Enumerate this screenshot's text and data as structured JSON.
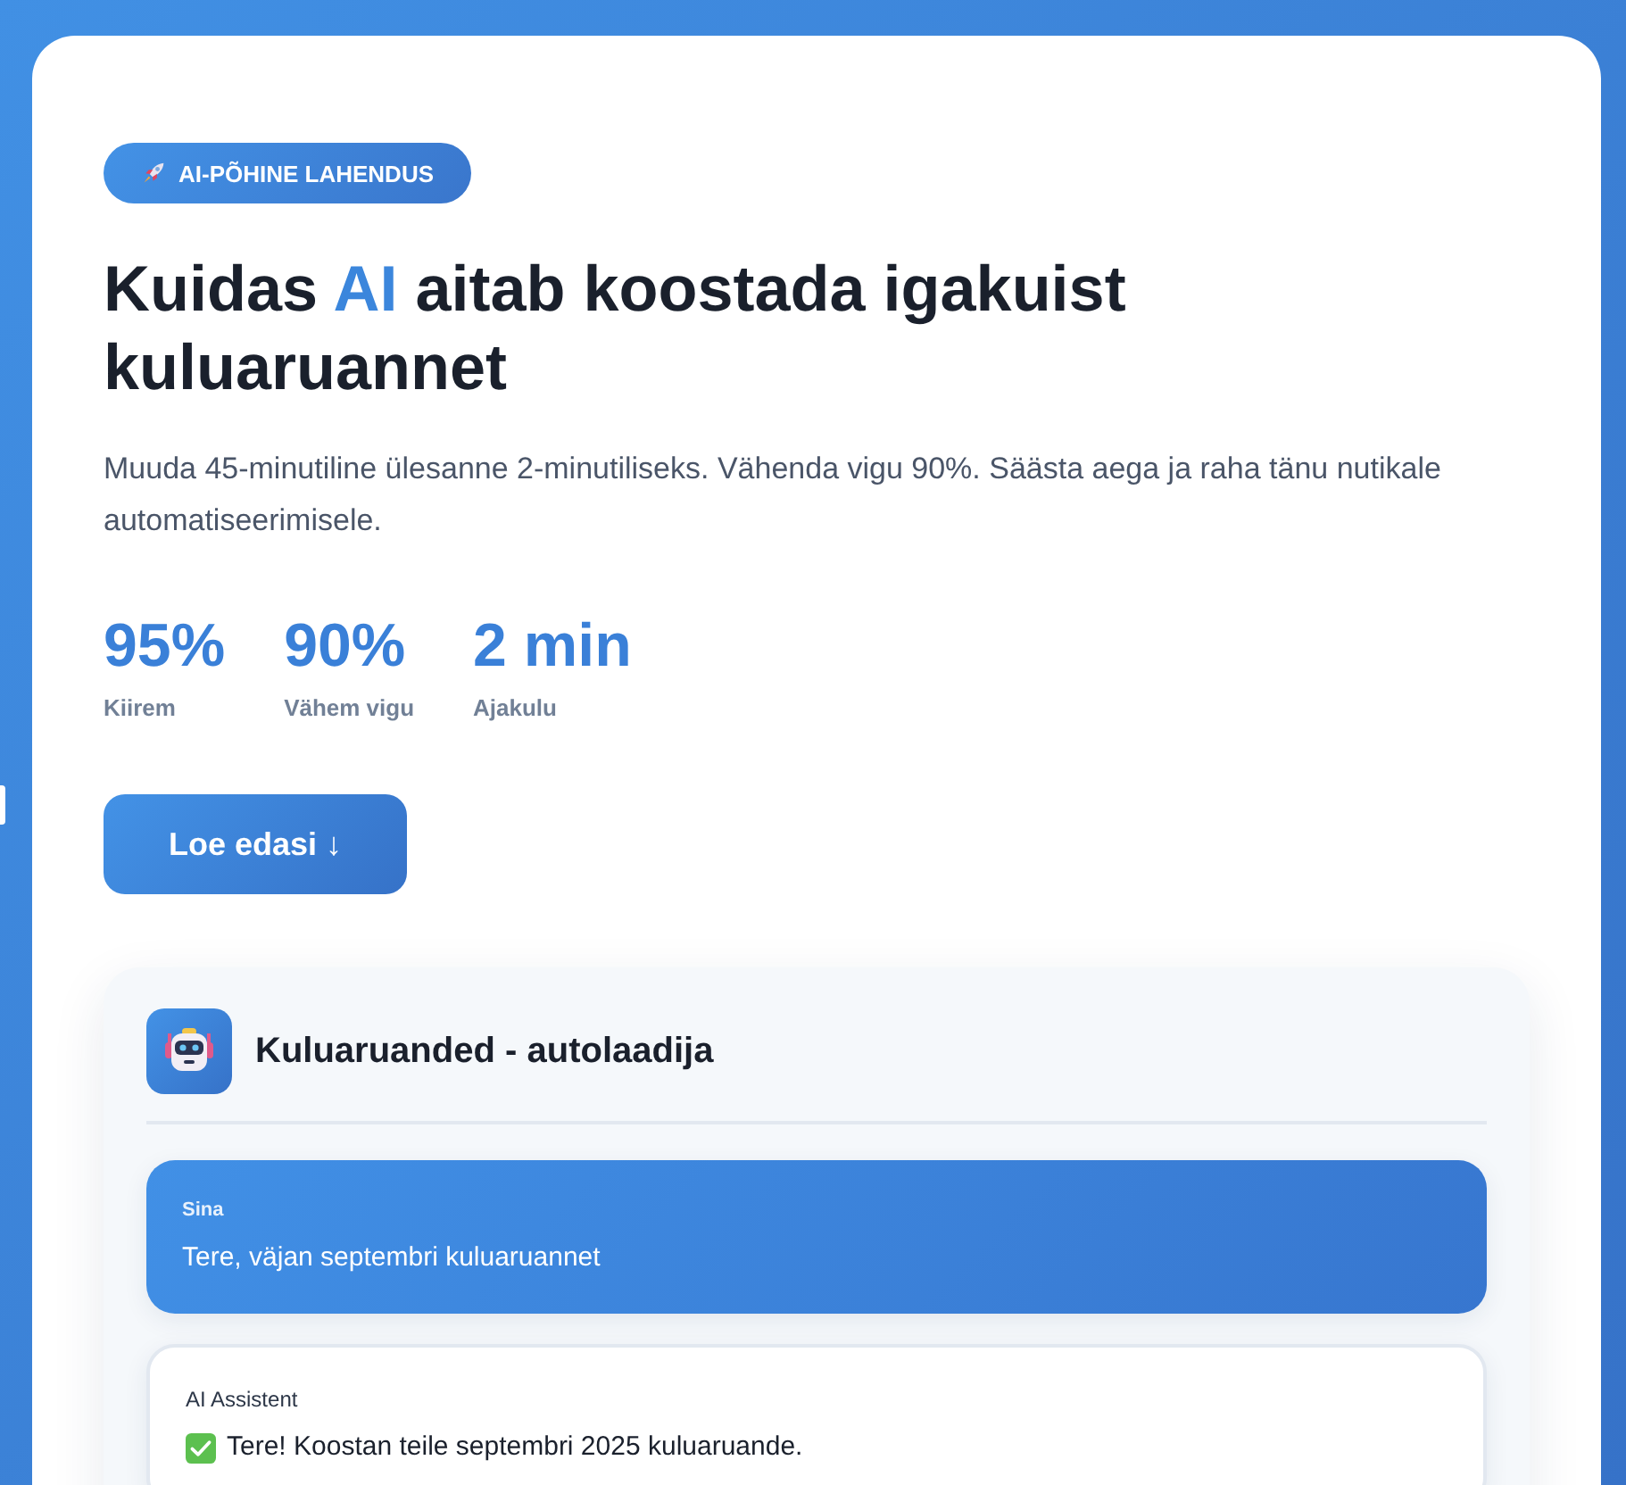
{
  "badge": {
    "text": "AI-PÕHINE LAHENDUS"
  },
  "headline": {
    "parts": [
      {
        "text": "Kuidas ",
        "highlight": false
      },
      {
        "text": "AI",
        "highlight": true
      },
      {
        "text": " aitab koostada igakuist kuluaruannet",
        "highlight": false
      }
    ]
  },
  "intro": "Muuda 45-minutiline ülesanne 2-minutiliseks. Vähenda vigu 90%. Säästa aega ja raha tänu nutikale automatiseerimisele.",
  "stats": [
    {
      "value": "95%",
      "label": "Kiirem"
    },
    {
      "value": "90%",
      "label": "Vähem vigu"
    },
    {
      "value": "2 min",
      "label": "Ajakulu"
    }
  ],
  "cta_button": {
    "label": "Loe edasi ↓"
  },
  "chat": {
    "title": "Kuluaruanded - autolaadija",
    "messages": [
      {
        "kind": "user",
        "sender": "Sina",
        "text": "Tere, väjan septembri kuluaruannet"
      },
      {
        "kind": "assistant",
        "sender": "AI Assistent",
        "text": "Tere! Koostan teile septembri 2025 kuluaruande."
      }
    ]
  }
}
